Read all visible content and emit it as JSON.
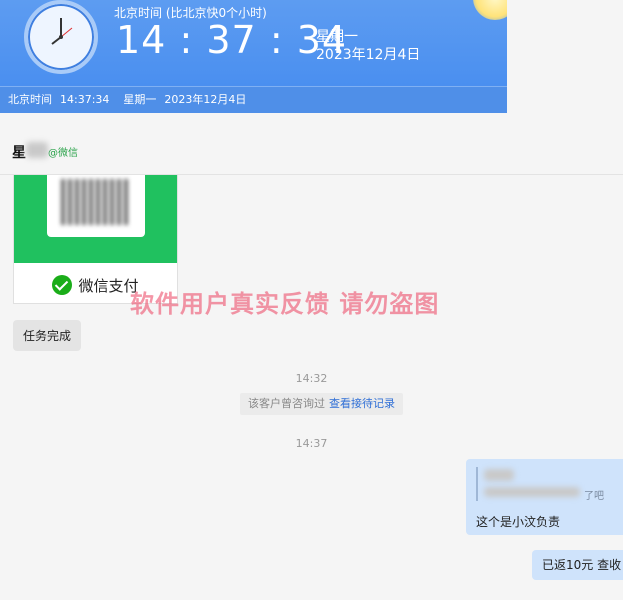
{
  "clock": {
    "label": "北京时间 (比北京快0个小时)",
    "time_h": "14",
    "time_m": "37",
    "time_s": "34",
    "weekday": "星期一",
    "date": "2023年12月4日"
  },
  "clock_bar": {
    "label": "北京时间",
    "time": "14:37:34",
    "weekday": "星期一",
    "date": "2023年12月4日"
  },
  "chat": {
    "contact_name": "星",
    "contact_source": "@微信",
    "pay_card_label": "微信支付",
    "watermark": "软件用户真实反馈  请勿盗图",
    "msg_task_done": "任务完成",
    "time_1": "14:32",
    "system_note": "该客户曾咨询过",
    "system_link": "查看接待记录",
    "time_2": "14:37",
    "quote_tail": "了吧",
    "reply_text": "这个是小汶负责",
    "msg_refund": "已返10元 查收"
  },
  "colors": {
    "clock_blue": "#4a8ff0",
    "wechat_green": "#20c15f",
    "bubble_blue": "#cfe3fb",
    "watermark_pink": "#ec506c",
    "link_blue": "#2f6fd6"
  }
}
